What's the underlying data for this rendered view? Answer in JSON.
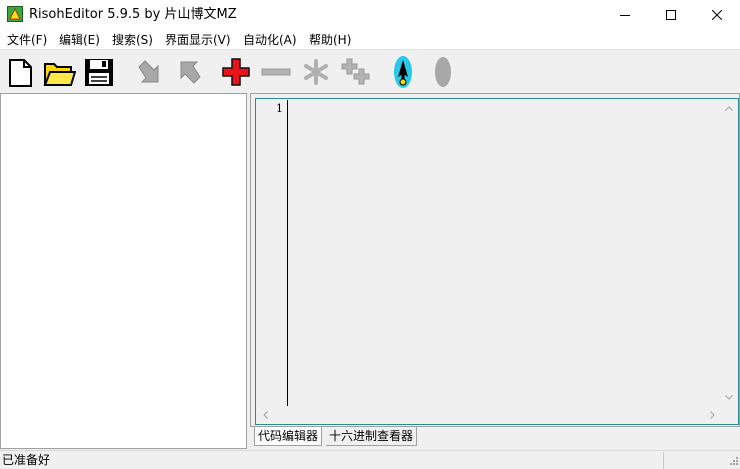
{
  "window": {
    "title": "RisohEditor 5.9.5 by 片山博文MZ",
    "icon": "app-triangle-icon",
    "controls": [
      "minimize-icon",
      "maximize-icon",
      "close-icon"
    ]
  },
  "menubar": {
    "items": [
      {
        "label": "文件(F)"
      },
      {
        "label": "编辑(E)"
      },
      {
        "label": "搜索(S)"
      },
      {
        "label": "界面显示(V)"
      },
      {
        "label": "自动化(A)"
      },
      {
        "label": "帮助(H)"
      }
    ]
  },
  "toolbar": {
    "buttons": [
      {
        "icon": "new-file-icon",
        "enabled": true
      },
      {
        "icon": "open-folder-icon",
        "enabled": true
      },
      {
        "icon": "save-disk-icon",
        "enabled": true
      },
      {
        "icon": "import-arrow-icon",
        "enabled": false
      },
      {
        "icon": "export-arrow-icon",
        "enabled": false
      },
      {
        "icon": "add-plus-icon",
        "enabled": true
      },
      {
        "icon": "delete-minus-icon",
        "enabled": false
      },
      {
        "icon": "edit-asterisk-icon",
        "enabled": false
      },
      {
        "icon": "clone-icon",
        "enabled": false
      },
      {
        "icon": "compile-rocket-icon",
        "enabled": true
      },
      {
        "icon": "ellipse-icon",
        "enabled": false
      }
    ]
  },
  "editor": {
    "line_numbers": [
      "1"
    ],
    "content": ""
  },
  "tabs": [
    {
      "label": "代码编辑器",
      "active": true
    },
    {
      "label": "十六进制查看器",
      "active": false
    }
  ],
  "status": {
    "text": "已准备好"
  },
  "colors": {
    "editor_border": "#2a8b92",
    "add_red": "#e8141a",
    "folder_yellow": "#ffd800",
    "rocket_cyan": "#28c8e8"
  }
}
